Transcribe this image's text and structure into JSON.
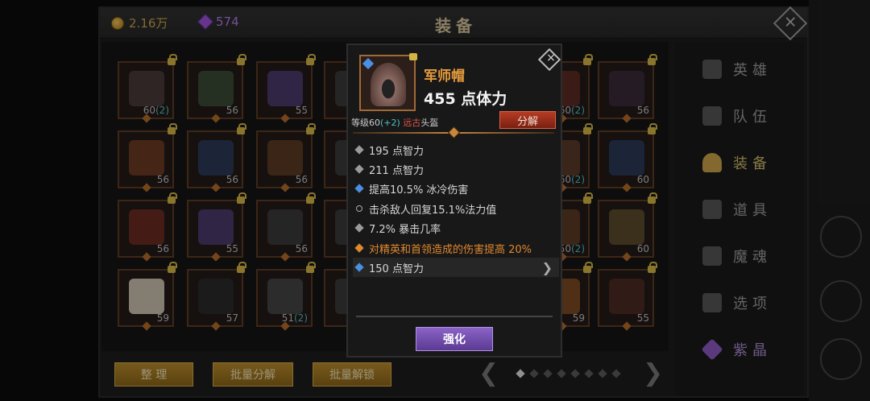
{
  "header": {
    "gold": "2.16万",
    "gems": "574",
    "title": "装备"
  },
  "inventory": [
    {
      "level": "60",
      "bonus": "(2)"
    },
    {
      "level": "56",
      "bonus": ""
    },
    {
      "level": "55",
      "bonus": ""
    },
    {
      "level": "",
      "bonus": ""
    },
    {
      "level": "60",
      "bonus": "(2)"
    },
    {
      "level": "56",
      "bonus": ""
    },
    {
      "level": "56",
      "bonus": ""
    },
    {
      "level": "56",
      "bonus": ""
    },
    {
      "level": "56",
      "bonus": ""
    },
    {
      "level": "",
      "bonus": ""
    },
    {
      "level": "60",
      "bonus": "(2)"
    },
    {
      "level": "60",
      "bonus": ""
    },
    {
      "level": "56",
      "bonus": ""
    },
    {
      "level": "55",
      "bonus": ""
    },
    {
      "level": "56",
      "bonus": ""
    },
    {
      "level": "",
      "bonus": ""
    },
    {
      "level": "50",
      "bonus": "(2)"
    },
    {
      "level": "60",
      "bonus": ""
    },
    {
      "level": "59",
      "bonus": ""
    },
    {
      "level": "57",
      "bonus": ""
    },
    {
      "level": "51",
      "bonus": "(2)"
    },
    {
      "level": "",
      "bonus": ""
    },
    {
      "level": "59",
      "bonus": ""
    },
    {
      "level": "55",
      "bonus": ""
    }
  ],
  "sidebar": {
    "items": [
      {
        "label": "英雄",
        "icon": "hero-icon"
      },
      {
        "label": "队伍",
        "icon": "flag-icon"
      },
      {
        "label": "装备",
        "icon": "helmet-icon"
      },
      {
        "label": "道具",
        "icon": "bag-icon"
      },
      {
        "label": "魔魂",
        "icon": "flame-icon"
      },
      {
        "label": "选项",
        "icon": "gear-icon"
      },
      {
        "label": "紫晶",
        "icon": "amethyst-icon"
      }
    ],
    "active_index": 2
  },
  "bottom": {
    "sort": "整 理",
    "bulk_decompose": "批量分解",
    "bulk_unlock": "批量解锁",
    "page_count": 8,
    "current_page": 1
  },
  "popup": {
    "name": "军师帽",
    "main_stat": "455 点体力",
    "level_prefix": "等级60",
    "level_bonus": "(+2)",
    "class_tag": "远古",
    "slot_type": "头盔",
    "decompose": "分解",
    "stats": [
      "195 点智力",
      "211 点智力",
      "提高10.5% 冰冷伤害",
      "击杀敌人回复15.1%法力值",
      "7.2% 暴击几率",
      "对精英和首领造成的伤害提高 20%"
    ],
    "socket": "150 点智力",
    "enhance": "强化"
  },
  "colors": {
    "legendary_orange": "#e69c3c",
    "enhance_purple": "#6f4aae",
    "decompose_red": "#9a2f1a",
    "gold_button": "#a37a22"
  }
}
